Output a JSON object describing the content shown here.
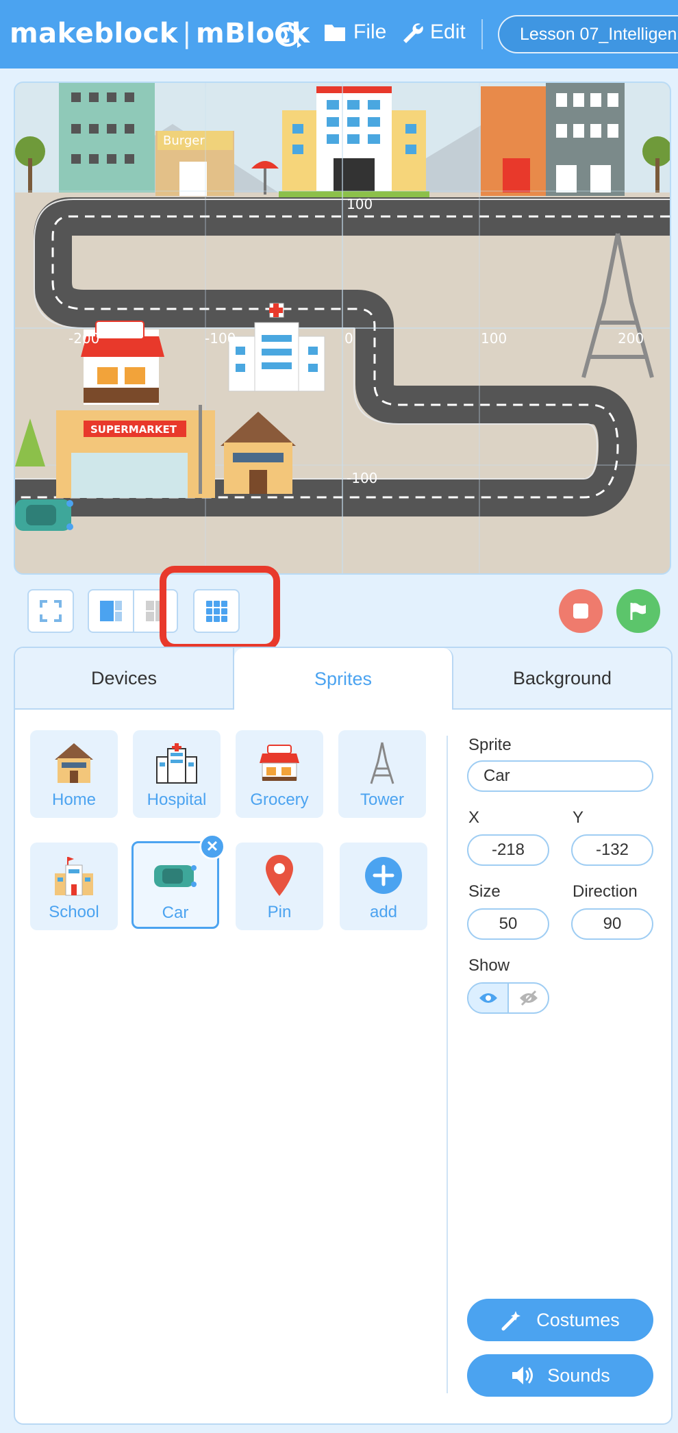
{
  "header": {
    "brand_left": "makeblock",
    "brand_sep": "|",
    "brand_right": "mBlock",
    "globe_icon": "globe-icon",
    "menu_file": "File",
    "menu_edit": "Edit",
    "project_title": "Lesson 07_Intelligen"
  },
  "stage": {
    "axis_labels": {
      "x_neg200": "-200",
      "x_neg100": "-100",
      "x_zero": "0",
      "x_100": "100",
      "x_200": "200",
      "y_100": "100",
      "y_neg100": "-100"
    },
    "signs": {
      "burger": "Burger",
      "supermarket": "SUPERMARKET"
    }
  },
  "toolbar": {
    "fullscreen_icon": "fullscreen-icon",
    "layout_wide_icon": "layout-wide-icon",
    "layout_small_icon": "layout-small-icon",
    "grid_icon": "grid-icon",
    "stop_icon": "stop-icon",
    "flag_icon": "green-flag-icon"
  },
  "tabs": [
    {
      "label": "Devices"
    },
    {
      "label": "Sprites"
    },
    {
      "label": "Background"
    }
  ],
  "sprites": [
    {
      "name": "Home"
    },
    {
      "name": "Hospital"
    },
    {
      "name": "Grocery"
    },
    {
      "name": "Tower"
    },
    {
      "name": "School"
    },
    {
      "name": "Car"
    },
    {
      "name": "Pin"
    },
    {
      "name": "add"
    }
  ],
  "properties": {
    "sprite_label": "Sprite",
    "sprite_value": "Car",
    "x_label": "X",
    "x_value": "-218",
    "y_label": "Y",
    "y_value": "-132",
    "size_label": "Size",
    "size_value": "50",
    "direction_label": "Direction",
    "direction_value": "90",
    "show_label": "Show"
  },
  "actions": {
    "costumes": "Costumes",
    "sounds": "Sounds"
  },
  "colors": {
    "accent": "#4ba3f0",
    "highlight": "#e8392b",
    "stop": "#ef7b6d",
    "go": "#5cc56b"
  }
}
